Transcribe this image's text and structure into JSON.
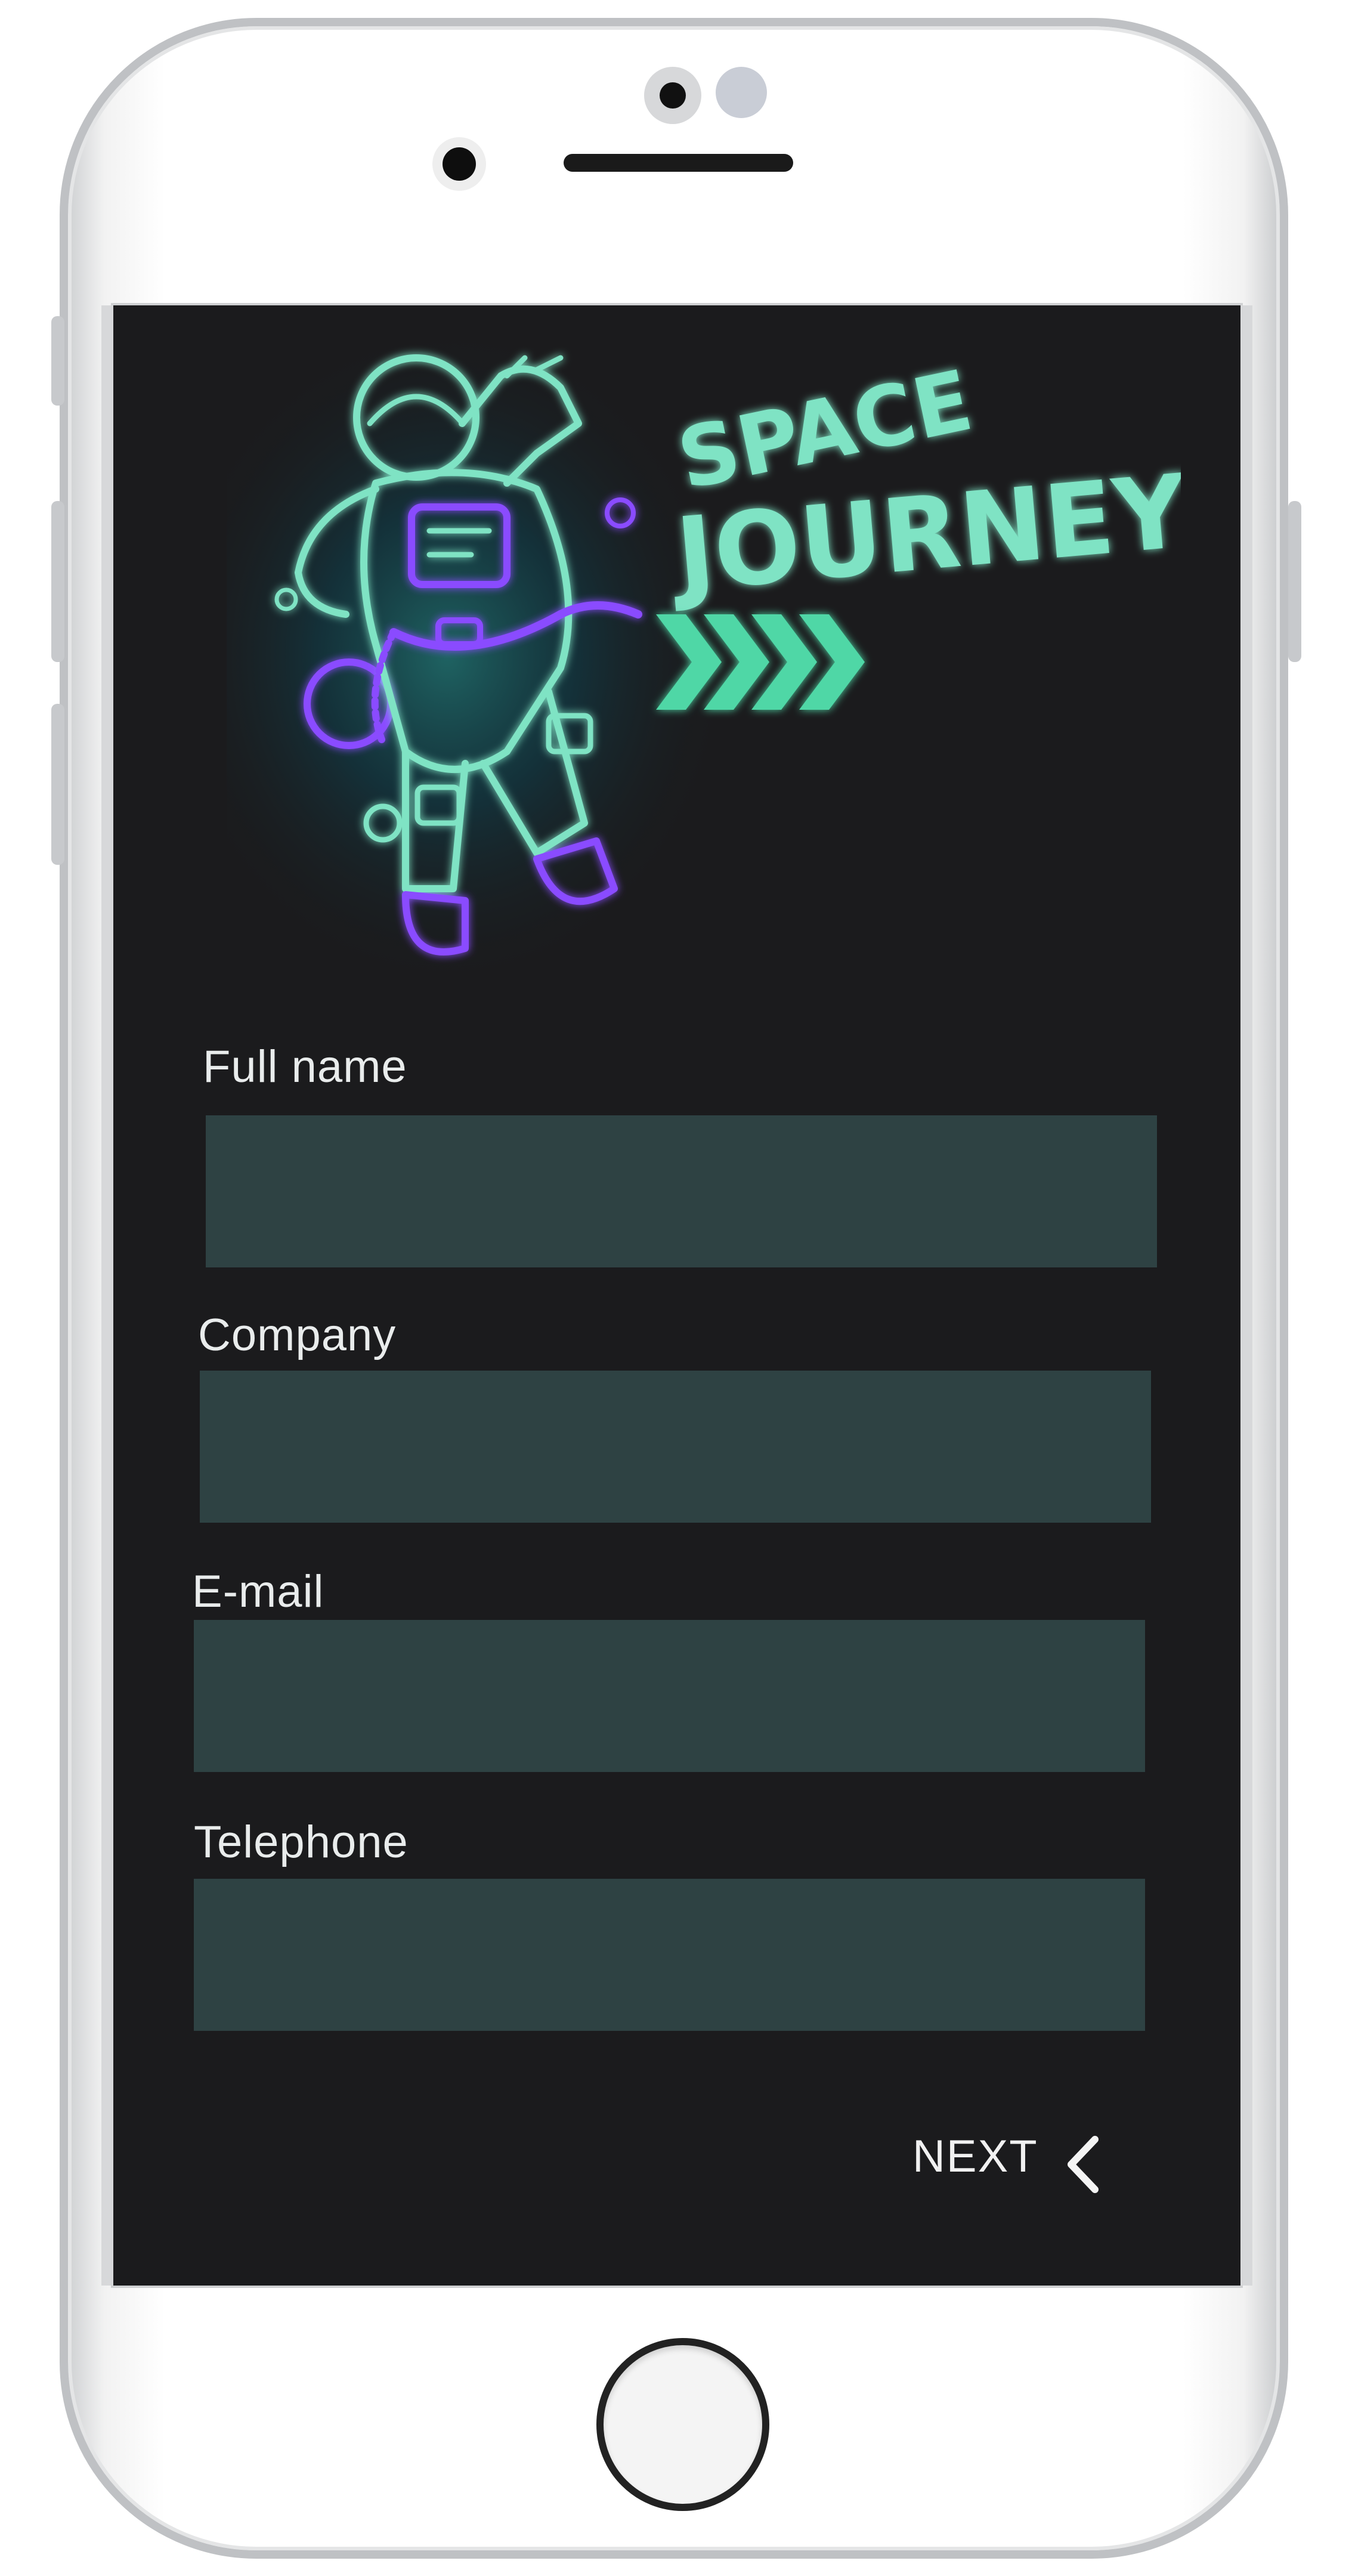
{
  "brand": {
    "title_line1": "SPACE",
    "title_line2": "JOURNEY",
    "neon_color": "#7fe3c4",
    "accent_violet": "#8a4cff"
  },
  "form": {
    "fields": [
      {
        "label": "Full name",
        "value": "",
        "placeholder": ""
      },
      {
        "label": "Company",
        "value": "",
        "placeholder": ""
      },
      {
        "label": "E-mail",
        "value": "",
        "placeholder": ""
      },
      {
        "label": "Telephone",
        "value": "",
        "placeholder": ""
      }
    ],
    "next_label": "NEXT",
    "next_icon": "chevron-left-icon"
  },
  "colors": {
    "screen_bg": "#1b1b1d",
    "input_bg": "#2e4243",
    "label_text": "#e9ecec"
  }
}
